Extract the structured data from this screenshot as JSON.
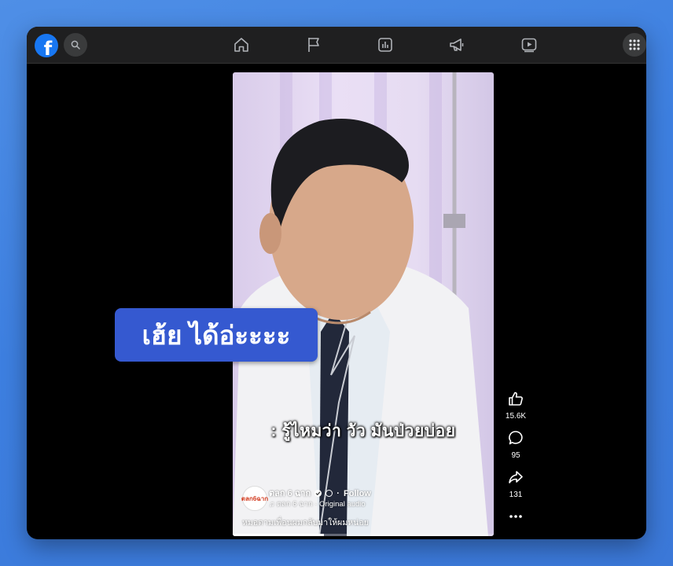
{
  "topbar": {
    "logo": "f",
    "icons": [
      "search-icon",
      "home-icon",
      "flag-icon",
      "chart-icon",
      "megaphone-icon",
      "video-icon",
      "grid-menu-icon"
    ]
  },
  "video": {
    "caption": ": รู้ไหมว่า วัว มันป่วยบ่อย",
    "page_name": "ตลก 6 ฉาก",
    "follow": "Follow",
    "audio": "ตลก 6 ฉาก · Original audio",
    "description": "หมอตามเพื่อนผมกลับมาให้ผมหน่อย",
    "avatar_text": "ตลก6ฉาก",
    "progress": 0.35
  },
  "banner": {
    "text": "เฮ้ย ได้อ่ะะะะ"
  },
  "actions": {
    "like_count": "15.6K",
    "comment_count": "95",
    "share_count": "131"
  }
}
